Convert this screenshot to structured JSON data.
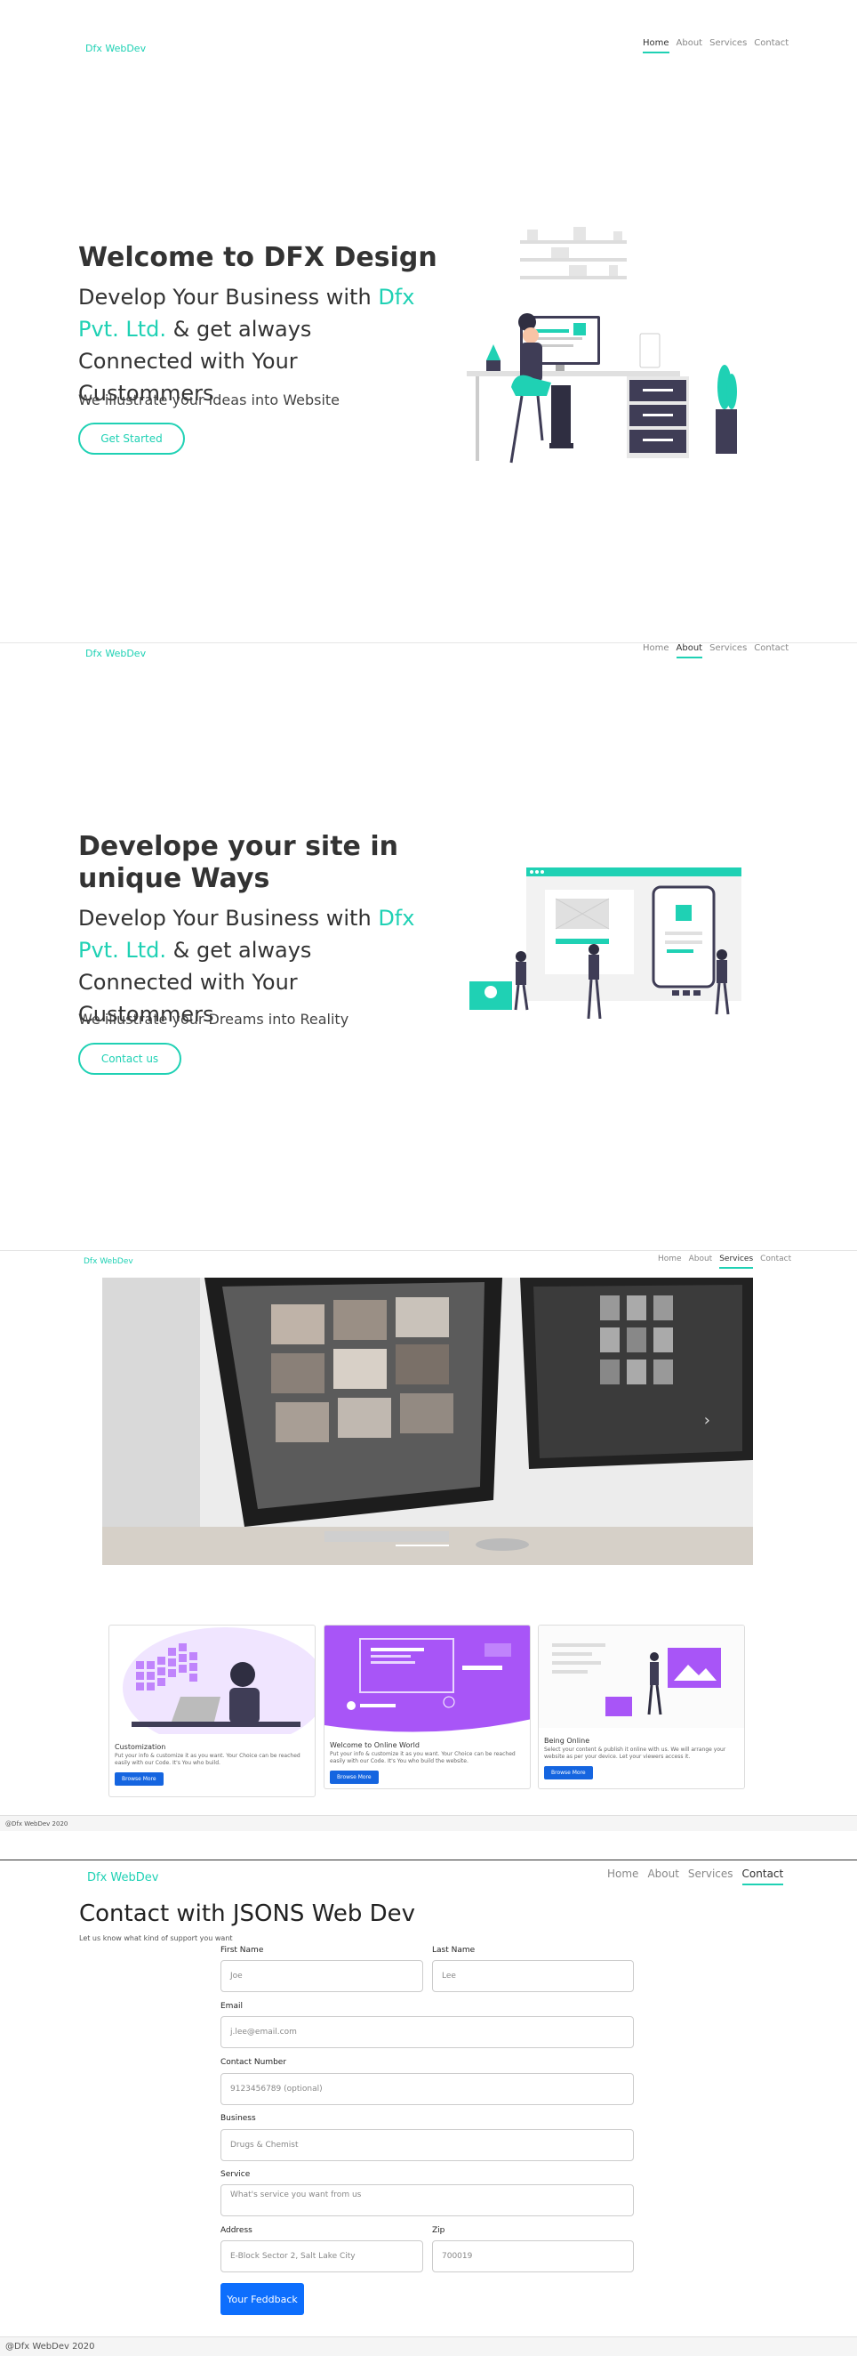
{
  "brand": "Dfx WebDev",
  "nav": [
    "Home",
    "About",
    "Services",
    "Contact"
  ],
  "section1": {
    "title": "Welcome to DFX Design",
    "sub_pre": "Develop Your Business with ",
    "sub_accent": "Dfx Pvt. Ltd.",
    "sub_post": " & get always Connected with Your Custommers",
    "tagline": "We illustrate your Ideas into Website",
    "cta": "Get Started"
  },
  "section2": {
    "title": "Develope your site in unique Ways",
    "sub_pre": "Develop Your Business with ",
    "sub_accent": "Dfx Pvt. Ltd.",
    "sub_post": " & get always Connected with Your Custommers",
    "tagline": "We illustrate your Dreams into Reality",
    "cta": "Contact us"
  },
  "services": {
    "cards": [
      {
        "title": "Customization",
        "text": "Put your info & customize it as you want. Your Choice can be reached easily with our Code. It's You who build.",
        "button": "Browse More"
      },
      {
        "title": "Welcome to Online World",
        "text": "Put your info & customize it as you want. Your Choice can be reached easily with our Code. It's You who build the website.",
        "button": "Browse More"
      },
      {
        "title": "Being Online",
        "text": "Select your content & publish it online with us. We will arrange your website as per your device. Let your viewers access it.",
        "button": "Browse More"
      }
    ],
    "footer": "@Dfx WebDev 2020"
  },
  "contact": {
    "title": "Contact with JSONS Web Dev",
    "subtitle": "Let us know what kind of support you want",
    "first_name_label": "First Name",
    "first_name_placeholder": "Joe",
    "last_name_label": "Last Name",
    "last_name_placeholder": "Lee",
    "email_label": "Email",
    "email_placeholder": "j.lee@email.com",
    "phone_label": "Contact Number",
    "phone_placeholder": "9123456789 (optional)",
    "business_label": "Business",
    "business_placeholder": "Drugs & Chemist",
    "service_label": "Service",
    "service_placeholder": "What's service you want from us",
    "address_label": "Address",
    "address_placeholder": "E-Block Sector 2, Salt Lake City",
    "zip_label": "Zip",
    "zip_placeholder": "700019",
    "submit": "Your Feddback",
    "footer": "@Dfx WebDev 2020"
  },
  "colors": {
    "accent": "#1fd1b4",
    "primary": "#0d6efd",
    "purple": "#a855f7"
  }
}
